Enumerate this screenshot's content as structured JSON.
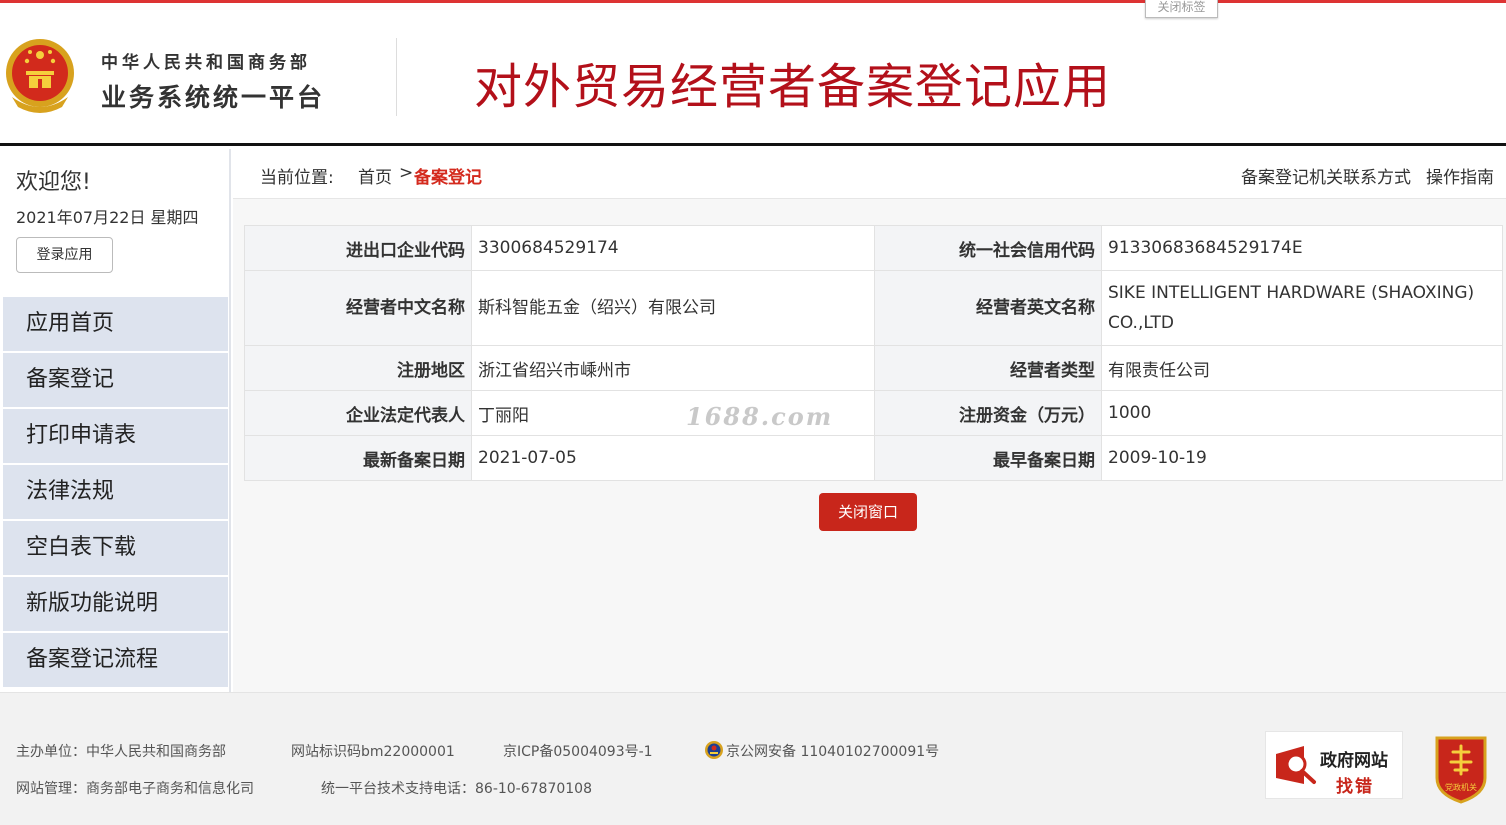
{
  "close_tag_label": "关闭标签",
  "header": {
    "ministry": "中华人民共和国商务部",
    "platform": "业务系统统一平台",
    "app_title": "对外贸易经营者备案登记应用"
  },
  "sidebar": {
    "welcome": "欢迎您!",
    "date": "2021年07月22日 星期四",
    "login_button": "登录应用",
    "menu": [
      {
        "label": "应用首页"
      },
      {
        "label": "备案登记"
      },
      {
        "label": "打印申请表"
      },
      {
        "label": "法律法规"
      },
      {
        "label": "空白表下载"
      },
      {
        "label": "新版功能说明"
      },
      {
        "label": "备案登记流程"
      }
    ]
  },
  "breadcrumb": {
    "label": "当前位置:",
    "home": "首页",
    "separator": ">",
    "current": "备案登记",
    "link_contact": "备案登记机关联系方式",
    "link_guide": "操作指南"
  },
  "record": {
    "rows": [
      {
        "label1": "进出口企业代码",
        "value1": "3300684529174",
        "label2": "统一社会信用代码",
        "value2": "91330683684529174E"
      },
      {
        "label1": "经营者中文名称",
        "value1": "斯科智能五金（绍兴）有限公司",
        "label2": "经营者英文名称",
        "value2": "SIKE INTELLIGENT HARDWARE (SHAOXING) CO.,LTD"
      },
      {
        "label1": "注册地区",
        "value1": "浙江省绍兴市嵊州市",
        "label2": "经营者类型",
        "value2": "有限责任公司"
      },
      {
        "label1": "企业法定代表人",
        "value1": "丁丽阳",
        "label2": "注册资金（万元）",
        "value2": "1000"
      },
      {
        "label1": "最新备案日期",
        "value1": "2021-07-05",
        "label2": "最早备案日期",
        "value2": "2009-10-19"
      }
    ]
  },
  "watermark": "1688.com",
  "close_window_button": "关闭窗口",
  "footer": {
    "sponsor": "主办单位：中华人民共和国商务部",
    "site_code": "网站标识码bm22000001",
    "icp": "京ICP备05004093号-1",
    "police": "京公网安备 11040102700091号",
    "manager": "网站管理：商务部电子商务和信息化司",
    "support": "统一平台技术支持电话：86-10-67870108",
    "gov_badge_line1": "政府网站",
    "gov_badge_line2": "找错",
    "party_badge_label": "党政机关"
  },
  "colors": {
    "brand_red": "#b3101a",
    "accent_red": "#d42a1e",
    "button_red": "#c8261b",
    "menu_bg": "#dde3ee",
    "label_bg": "#f3f4f6"
  }
}
